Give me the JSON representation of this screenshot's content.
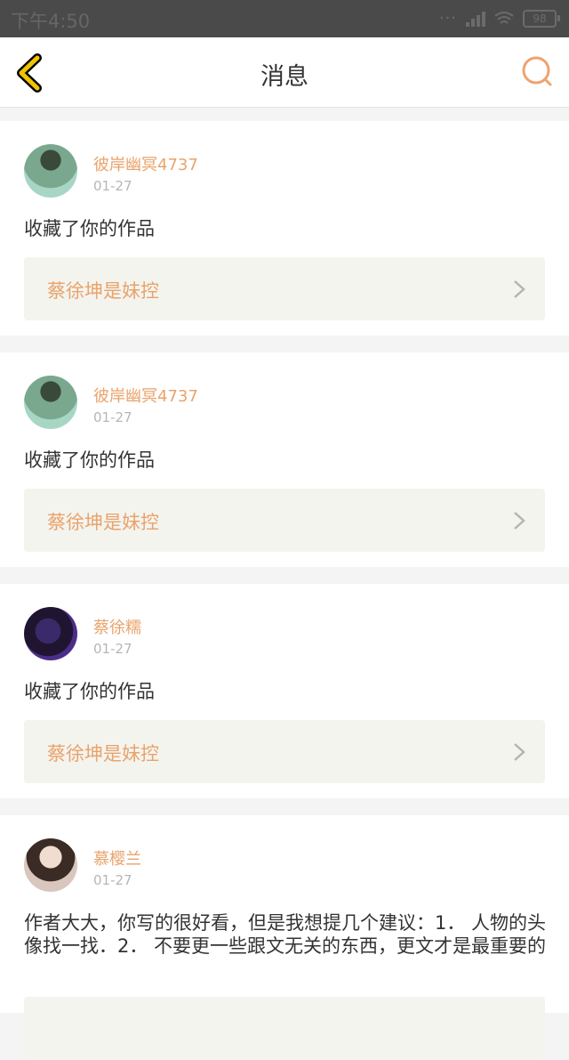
{
  "status": {
    "time": "下午4:50",
    "battery": "98"
  },
  "nav": {
    "title": "消息"
  },
  "messages": [
    {
      "username": "彼岸幽冥4737",
      "date": "01-27",
      "text": "收藏了你的作品",
      "work": "蔡徐坤是妹控"
    },
    {
      "username": "彼岸幽冥4737",
      "date": "01-27",
      "text": "收藏了你的作品",
      "work": "蔡徐坤是妹控"
    },
    {
      "username": "蔡徐糯",
      "date": "01-27",
      "text": "收藏了你的作品",
      "work": "蔡徐坤是妹控"
    },
    {
      "username": "慕樱兰",
      "date": "01-27",
      "text": "作者大大，你写的很好看，但是我想提几个建议：1． 人物的头像找一找．2． 不要更一些跟文无关的东西，更文才是最重要的",
      "work": ""
    }
  ],
  "colors": {
    "accent": "#e9a36b",
    "background": "#f4f4f4",
    "work_box": "#f4f4ef",
    "back_arrow": "#f0c400"
  },
  "icons": {
    "back": "back-arrow-icon",
    "search": "search-icon",
    "chevron": "chevron-right-icon"
  }
}
